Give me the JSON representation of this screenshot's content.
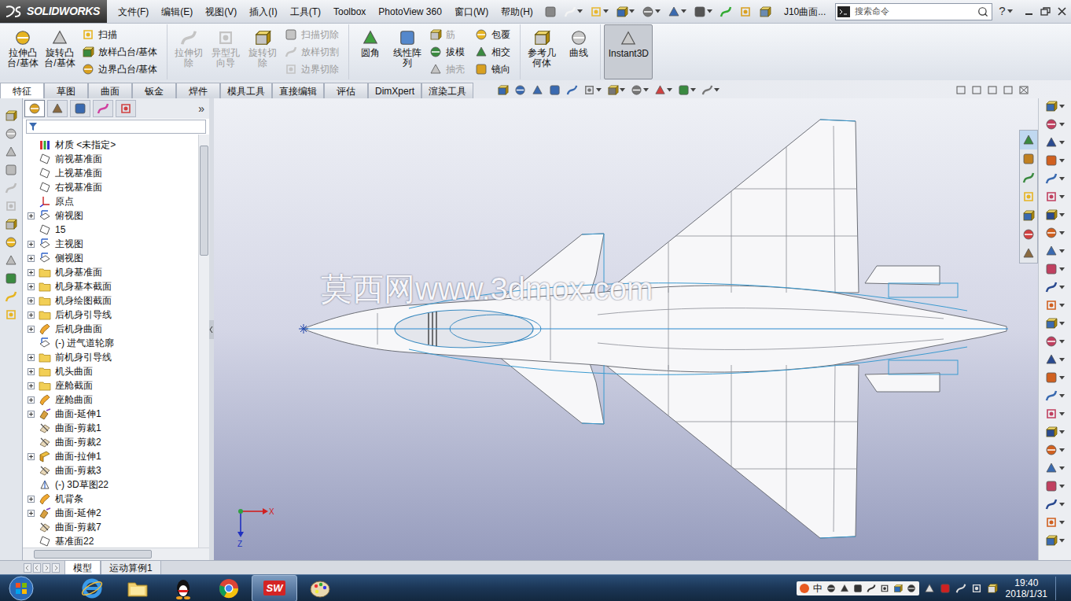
{
  "app": {
    "logo": "SOLIDWORKS",
    "document": "J10曲面...",
    "search": {
      "placeholder": "搜索命令"
    },
    "help": "?"
  },
  "menus": [
    "文件(F)",
    "编辑(E)",
    "视图(V)",
    "插入(I)",
    "工具(T)",
    "Toolbox",
    "PhotoView 360",
    "窗口(W)",
    "帮助(H)"
  ],
  "ribbon": [
    [
      {
        "kind": "large",
        "label": "拉伸凸台/基体",
        "disabled": false,
        "selected": false
      },
      {
        "kind": "large",
        "label": "旋转凸台/基体",
        "disabled": false,
        "selected": false
      },
      {
        "kind": "stack",
        "items": [
          {
            "label": "扫描",
            "disabled": false
          },
          {
            "label": "放样凸台/基体",
            "disabled": false
          },
          {
            "label": "边界凸台/基体",
            "disabled": false
          }
        ]
      }
    ],
    [
      {
        "kind": "large",
        "label": "拉伸切除",
        "disabled": true,
        "selected": false
      },
      {
        "kind": "large",
        "label": "异型孔向导",
        "disabled": true,
        "selected": false
      },
      {
        "kind": "large",
        "label": "旋转切除",
        "disabled": true,
        "selected": false
      },
      {
        "kind": "stack",
        "items": [
          {
            "label": "扫描切除",
            "disabled": true
          },
          {
            "label": "放样切割",
            "disabled": true
          },
          {
            "label": "边界切除",
            "disabled": true
          }
        ]
      }
    ],
    [
      {
        "kind": "large",
        "label": "圆角",
        "disabled": false,
        "selected": false
      },
      {
        "kind": "large",
        "label": "线性阵列",
        "disabled": false,
        "selected": false
      },
      {
        "kind": "stack",
        "items": [
          {
            "label": "筋",
            "disabled": true
          },
          {
            "label": "拔模",
            "disabled": false
          },
          {
            "label": "抽壳",
            "disabled": true
          }
        ]
      },
      {
        "kind": "stack",
        "items": [
          {
            "label": "包覆",
            "disabled": false
          },
          {
            "label": "相交",
            "disabled": false
          },
          {
            "label": "镜向",
            "disabled": false
          }
        ]
      }
    ],
    [
      {
        "kind": "large",
        "label": "参考几何体",
        "disabled": false,
        "selected": false
      },
      {
        "kind": "large",
        "label": "曲线",
        "disabled": false,
        "selected": false
      }
    ],
    [
      {
        "kind": "large",
        "label": "Instant3D",
        "disabled": false,
        "selected": true
      }
    ]
  ],
  "tabs": [
    {
      "label": "特征",
      "selected": true
    },
    {
      "label": "草图",
      "selected": false
    },
    {
      "label": "曲面",
      "selected": false
    },
    {
      "label": "钣金",
      "selected": false
    },
    {
      "label": "焊件",
      "selected": false
    },
    {
      "label": "模具工具",
      "selected": false
    },
    {
      "label": "直接编辑",
      "selected": false
    },
    {
      "label": "评估",
      "selected": false
    },
    {
      "label": "DimXpert",
      "selected": false
    },
    {
      "label": "渲染工具",
      "selected": false
    }
  ],
  "panel": {
    "more": "»",
    "tabs": [
      {
        "selected": true
      },
      {
        "selected": false
      },
      {
        "selected": false
      },
      {
        "selected": false
      },
      {
        "selected": false
      }
    ]
  },
  "tree": [
    {
      "label": "材质 <未指定>",
      "kind": "material",
      "expandable": false
    },
    {
      "label": "前视基准面",
      "kind": "plane",
      "expandable": false
    },
    {
      "label": "上视基准面",
      "kind": "plane",
      "expandable": false
    },
    {
      "label": "右视基准面",
      "kind": "plane",
      "expandable": false
    },
    {
      "label": "原点",
      "kind": "origin",
      "expandable": false
    },
    {
      "label": "俯视图",
      "kind": "sketch",
      "expandable": true
    },
    {
      "label": "15",
      "kind": "plane",
      "expandable": false
    },
    {
      "label": "主视图",
      "kind": "sketch",
      "expandable": true
    },
    {
      "label": "侧视图",
      "kind": "sketch",
      "expandable": true
    },
    {
      "label": "机身基准面",
      "kind": "folder",
      "expandable": true
    },
    {
      "label": "机身基本截面",
      "kind": "folder",
      "expandable": true
    },
    {
      "label": "机身绘图截面",
      "kind": "folder",
      "expandable": true
    },
    {
      "label": "后机身引导线",
      "kind": "folder",
      "expandable": true
    },
    {
      "label": "后机身曲面",
      "kind": "surface",
      "expandable": true
    },
    {
      "label": "(-) 进气道轮廓",
      "kind": "sketch",
      "expandable": false
    },
    {
      "label": "前机身引导线",
      "kind": "folder",
      "expandable": true
    },
    {
      "label": "机头曲面",
      "kind": "folder",
      "expandable": true
    },
    {
      "label": "座舱截面",
      "kind": "folder",
      "expandable": true
    },
    {
      "label": "座舱曲面",
      "kind": "surface",
      "expandable": true
    },
    {
      "label": "曲面-延伸1",
      "kind": "extend",
      "expandable": true
    },
    {
      "label": "曲面-剪裁1",
      "kind": "trim",
      "expandable": false
    },
    {
      "label": "曲面-剪裁2",
      "kind": "trim",
      "expandable": false
    },
    {
      "label": "曲面-拉伸1",
      "kind": "extrude",
      "expandable": true
    },
    {
      "label": "曲面-剪裁3",
      "kind": "trim",
      "expandable": false
    },
    {
      "label": "(-) 3D草图22",
      "kind": "sketch3d",
      "expandable": false
    },
    {
      "label": "机背条",
      "kind": "surface",
      "expandable": true
    },
    {
      "label": "曲面-延伸2",
      "kind": "extend",
      "expandable": true
    },
    {
      "label": "曲面-剪裁7",
      "kind": "trim",
      "expandable": false
    },
    {
      "label": "基准面22",
      "kind": "plane",
      "expandable": false
    }
  ],
  "bottom_tabs": [
    {
      "label": "模型",
      "selected": true
    },
    {
      "label": "运动算例1",
      "selected": false
    }
  ],
  "viewport": {
    "watermark": "莫西网www.3dmox.com",
    "triad": {
      "x": "X",
      "z": "Z"
    }
  },
  "taskbar": {
    "apps": [
      {
        "kind": "ie",
        "label": "",
        "selected": false
      },
      {
        "kind": "folder",
        "label": "",
        "selected": false
      },
      {
        "kind": "qq",
        "label": "",
        "selected": false
      },
      {
        "kind": "chrome",
        "label": "",
        "selected": false
      },
      {
        "kind": "solidworks",
        "label": "SW",
        "selected": true
      },
      {
        "kind": "paint",
        "label": "",
        "selected": false
      }
    ],
    "ime": "中",
    "time": "19:40",
    "date": "2018/1/31"
  }
}
